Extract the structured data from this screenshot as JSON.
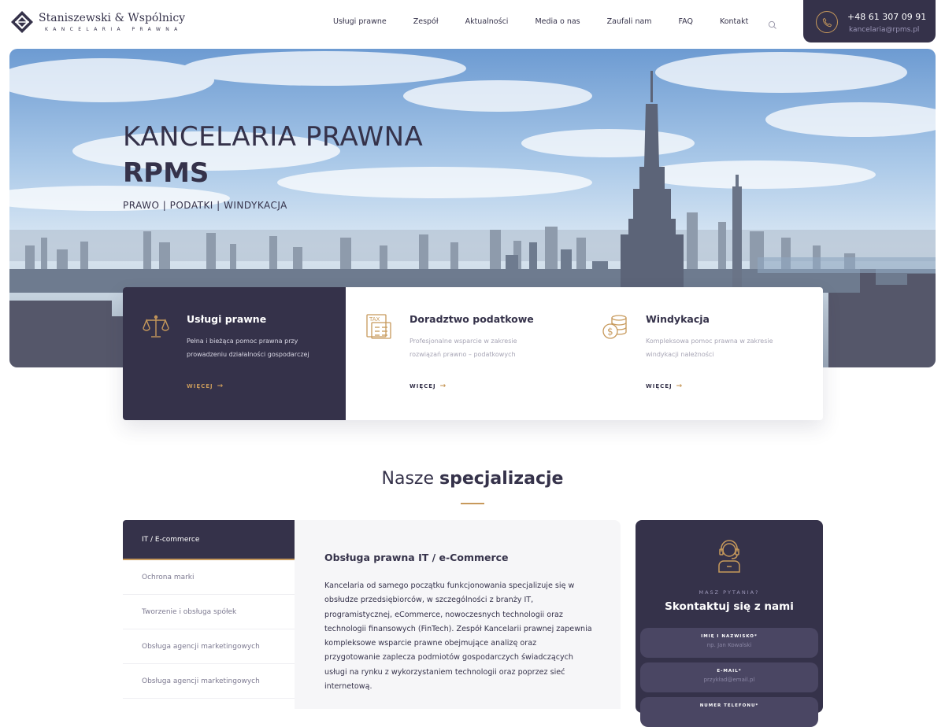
{
  "header": {
    "logo_name": "Staniszewski & Wspólnicy",
    "logo_sub": "KANCELARIA PRAWNA",
    "nav": [
      "Usługi prawne",
      "Zespół",
      "Aktualności",
      "Media o nas",
      "Zaufali nam",
      "FAQ",
      "Kontakt"
    ],
    "phone": "+48 61 307 09 91",
    "email": "kancelaria@rpms.pl"
  },
  "hero": {
    "title_line1": "KANCELARIA PRAWNA",
    "title_line2": "RPMS",
    "subtitle": "PRAWO | PODATKI | WINDYKACJA"
  },
  "services": [
    {
      "title": "Usługi prawne",
      "desc": "Pełna i bieżąca pomoc prawna przy prowadzeniu działalności gospodarczej",
      "more": "WIĘCEJ",
      "icon": "scales-icon"
    },
    {
      "title": "Doradztwo podatkowe",
      "desc": "Profesjonalne wsparcie w zakresie rozwiązań prawno – podatkowych",
      "more": "WIĘCEJ",
      "icon": "tax-document-icon"
    },
    {
      "title": "Windykacja",
      "desc": "Kompleksowa pomoc prawna w zakresie windykacji należności",
      "more": "WIĘCEJ",
      "icon": "coins-icon"
    }
  ],
  "specializations": {
    "title_light": "Nasze",
    "title_bold": "specjalizacje",
    "tabs": [
      "IT / E-commerce",
      "Ochrona marki",
      "Tworzenie i obsługa spółek",
      "Obsługa agencji marketingowych",
      "Obsługa agencji marketingowych"
    ],
    "content_title": "Obsługa prawna IT / e-Commerce",
    "content_body": "Kancelaria od samego początku funkcjonowania specjalizuje się w obsłudze przedsiębiorców, w szczególności z branży IT, programistycznej, eCommerce, nowoczesnych technologii oraz technologii finansowych (FinTech). Zespół Kancelarii prawnej zapewnia kompleksowe wsparcie prawne obejmujące analizę oraz przygotowanie zaplecza podmiotów gospodarczych świadczących usługi na rynku z wykorzystaniem technologii oraz poprzez sieć internetową."
  },
  "contact_form": {
    "kicker": "MASZ PYTANIA?",
    "title": "Skontaktuj się z nami",
    "fields": [
      {
        "label": "IMIĘ I NAZWISKO*",
        "placeholder": "np. Jan Kowalski"
      },
      {
        "label": "E-MAIL*",
        "placeholder": "przykład@email.pl"
      },
      {
        "label": "NUMER TELEFONU*",
        "placeholder": ""
      }
    ]
  },
  "colors": {
    "navy": "#35324a",
    "gold": "#c7995b"
  }
}
